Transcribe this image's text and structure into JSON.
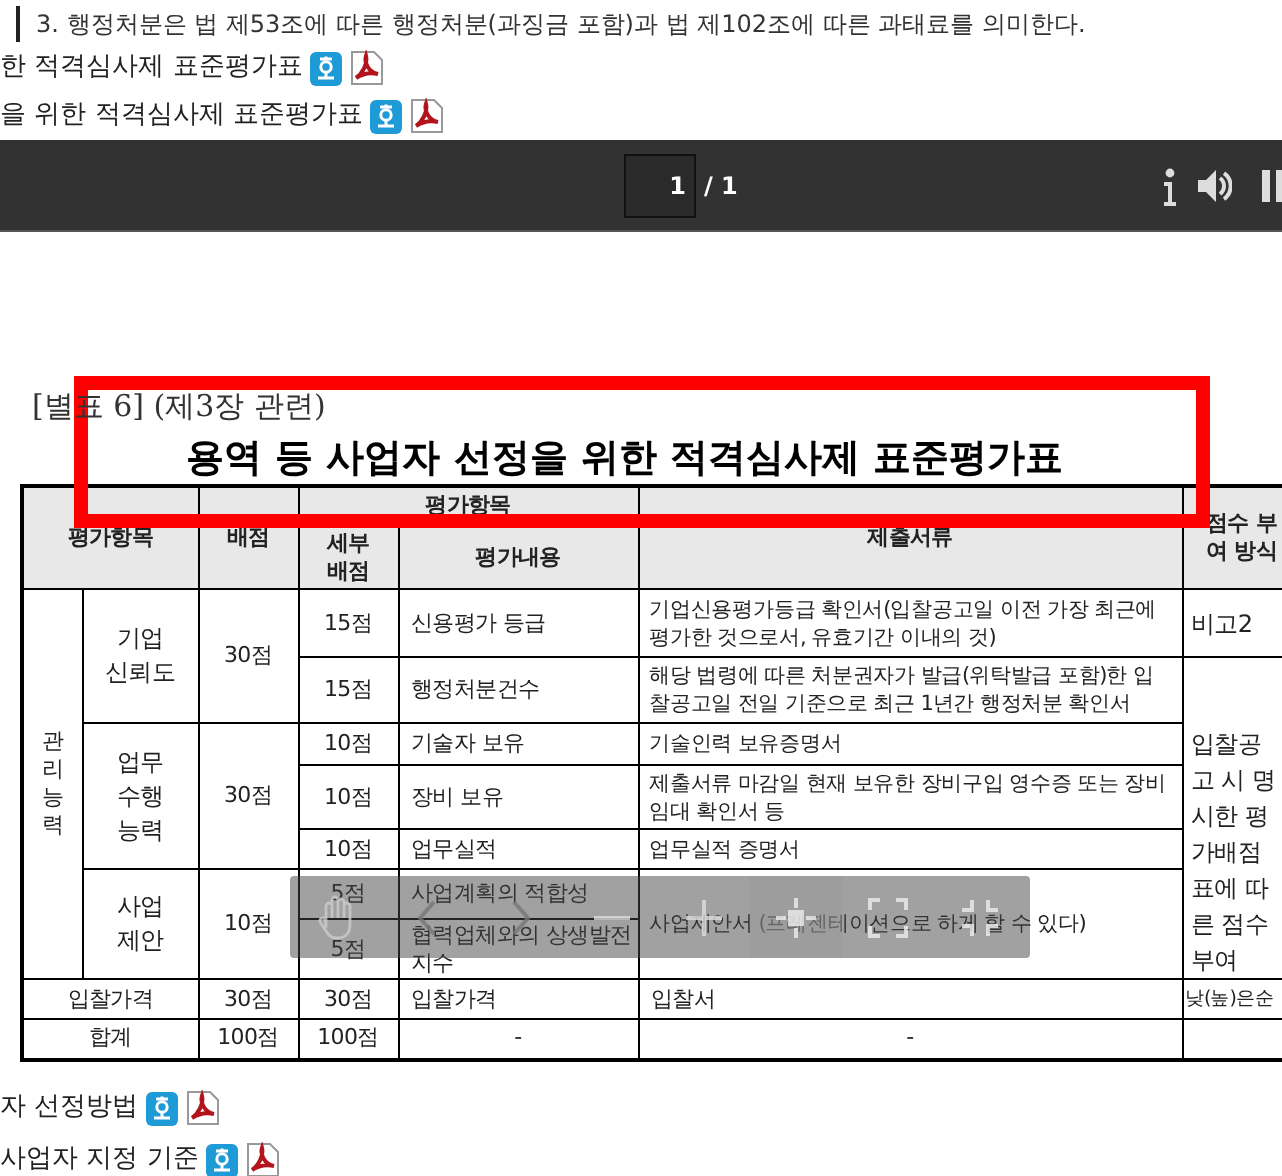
{
  "notice": "3. 행정처분은 법 제53조에 따른 행정처분(과징금 포함)과 법 제102조에 따른 과태료를 의미한다.",
  "top_links": [
    {
      "title": "한 적격심사제 표준평가표"
    },
    {
      "title": "을 위한 적격심사제 표준평가표"
    }
  ],
  "viewer_bar": {
    "page_input": "1",
    "page_total": "/ 1"
  },
  "document": {
    "caption": "[별표 6] (제3장 관련)",
    "title": "용역 등 사업자 선정을 위한 적격심사제 표준평가표",
    "header": {
      "item": "평가항목",
      "points": "배점",
      "evaluation": "평가항목",
      "sub_points": "세부 배점",
      "content": "평가내용",
      "documents": "제출서류",
      "method": "점수 부여 방식"
    },
    "categories": [
      {
        "label": "관리능력",
        "groups": [
          {
            "label": "기업 신뢰도",
            "points": "30점",
            "items": [
              {
                "points": "15점",
                "criterion": "신용평가 등급",
                "documents": "기업신용평가등급 확인서(입찰공고일 이전 가장 최근에 평가한 것으로서, 유효기간 이내의 것)",
                "method": "비고2"
              },
              {
                "points": "15점",
                "criterion": "행정처분건수",
                "documents": "해당 법령에 따른 처분권자가 발급(위탁발급 포함)한 입찰공고일 전일 기준으로 최근 1년간 행정처분 확인서",
                "method": "입찰공고 시 명시한 평가배점 표에 따른 점수부여"
              }
            ]
          },
          {
            "label": "업무 수행 능력",
            "points": "30점",
            "items": [
              {
                "points": "10점",
                "criterion": "기술자 보유",
                "documents": "기술인력 보유증명서"
              },
              {
                "points": "10점",
                "criterion": "장비 보유",
                "documents": "제출서류 마감일 현재 보유한 장비구입 영수증 또는 장비임대 확인서 등"
              },
              {
                "points": "10점",
                "criterion": "업무실적",
                "documents": "업무실적 증명서"
              }
            ]
          },
          {
            "label": "사업 제안",
            "points": "10점",
            "items": [
              {
                "points": "5점",
                "criterion": "사업계획의 적합성",
                "documents": "사업제안서 (프레젠테이션으로 하게 할 수 있다)"
              },
              {
                "points": "5점",
                "criterion": "협력업체와의 상생발전 지수"
              }
            ]
          }
        ]
      }
    ],
    "summary_rows": [
      {
        "label": "입찰가격",
        "points": "30점",
        "sub_points": "30점",
        "criterion": "입찰가격",
        "documents": "입찰서",
        "method": "낮(높)은순"
      },
      {
        "label": "합계",
        "points": "100점",
        "sub_points": "100점",
        "criterion": "-",
        "documents": "-"
      }
    ]
  },
  "zoom_toolbar": [
    {
      "kind": "hand",
      "selected": false
    },
    {
      "kind": "prev",
      "selected": false
    },
    {
      "kind": "next",
      "selected": false
    },
    {
      "kind": "zoom-out",
      "selected": false
    },
    {
      "kind": "zoom-in",
      "selected": false
    },
    {
      "kind": "fit",
      "selected": true
    },
    {
      "kind": "fullscreen",
      "selected": false
    },
    {
      "kind": "exit-fullscreen",
      "selected": false
    }
  ],
  "bottom_links": [
    {
      "title": "자 선정방법"
    },
    {
      "title": "사업자 지정 기준"
    }
  ]
}
